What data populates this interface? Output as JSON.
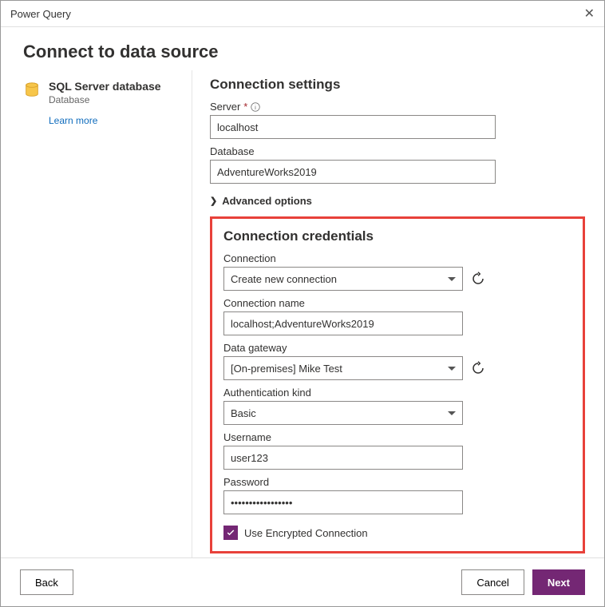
{
  "window": {
    "title": "Power Query"
  },
  "page": {
    "heading": "Connect to data source"
  },
  "left": {
    "title": "SQL Server database",
    "subtitle": "Database",
    "learn_more": "Learn more"
  },
  "settings": {
    "heading": "Connection settings",
    "server_label": "Server",
    "server_value": "localhost",
    "database_label": "Database",
    "database_value": "AdventureWorks2019",
    "advanced": "Advanced options"
  },
  "credentials": {
    "heading": "Connection credentials",
    "connection_label": "Connection",
    "connection_value": "Create new connection",
    "conn_name_label": "Connection name",
    "conn_name_value": "localhost;AdventureWorks2019",
    "gateway_label": "Data gateway",
    "gateway_value": "[On-premises] Mike Test",
    "auth_label": "Authentication kind",
    "auth_value": "Basic",
    "username_label": "Username",
    "username_value": "user123",
    "password_label": "Password",
    "password_value": "•••••••••••••••••",
    "encrypted_label": "Use Encrypted Connection"
  },
  "footer": {
    "back": "Back",
    "cancel": "Cancel",
    "next": "Next"
  }
}
